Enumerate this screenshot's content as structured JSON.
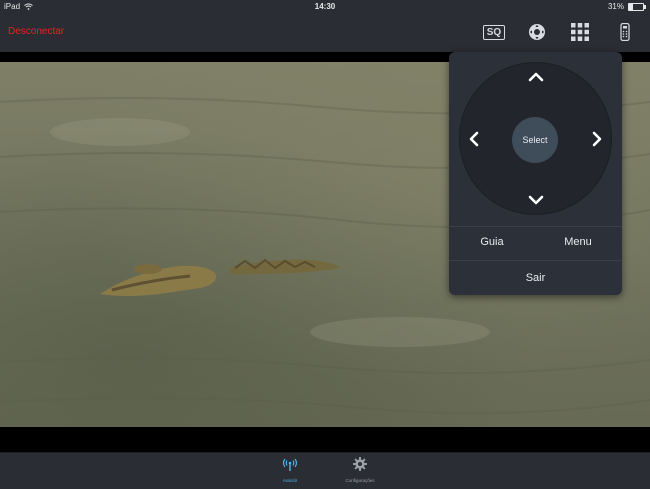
{
  "status_bar": {
    "device": "iPad",
    "time": "14:30",
    "battery": "31%",
    "battery_level": 0.31
  },
  "top_bar": {
    "disconnect_label": "Desconectar",
    "sq_label": "SQ",
    "icons": [
      "sq-icon",
      "remote-dpad-icon",
      "keypad-grid-icon",
      "remote-control-icon"
    ],
    "accent_color": "#e8221f"
  },
  "remote_panel": {
    "select_label": "Select",
    "guide_label": "Guia",
    "menu_label": "Menu",
    "exit_label": "Sair"
  },
  "bottom_tabs": {
    "tabs": [
      {
        "label": "Assistir",
        "icon": "antenna-icon",
        "active": true
      },
      {
        "label": "Configurações",
        "icon": "gear-icon",
        "active": false
      }
    ],
    "active_color": "#4fb3e8"
  }
}
